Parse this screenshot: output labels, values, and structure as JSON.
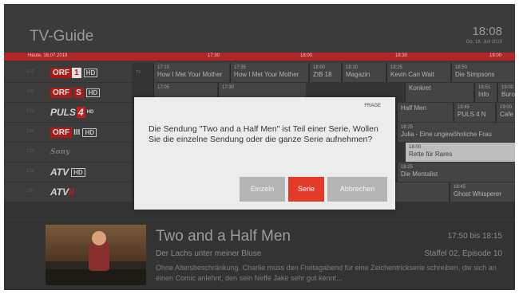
{
  "header": {
    "title": "TV-Guide",
    "clock": "18:08",
    "date": "Do, 18. Juli 2019"
  },
  "timeline": {
    "today": "Heute, 18.07.2019",
    "ticks": [
      "17:30",
      "18:00",
      "18:30",
      "19:00"
    ]
  },
  "channels": [
    {
      "num": "101",
      "logo": "orf1-logo",
      "name_a": "ORF",
      "name_b": "1",
      "hd": "HD"
    },
    {
      "num": "102",
      "logo": "orfs-logo",
      "name_a": "ORF",
      "name_b": "S",
      "hd": "HD"
    },
    {
      "num": "103",
      "logo": "puls4-logo",
      "name_a": "PULS",
      "name_b": "4",
      "hd": "HD"
    },
    {
      "num": "104",
      "logo": "orf3-logo",
      "name_a": "ORF",
      "name_b": "III",
      "hd": "HD"
    },
    {
      "num": "105",
      "logo": "script-logo",
      "name_a": "Sony",
      "name_b": "",
      "hd": ""
    },
    {
      "num": "106",
      "logo": "atv-logo",
      "name_a": "ATV",
      "name_b": "",
      "hd": "HD"
    },
    {
      "num": "107",
      "logo": "atv2-logo",
      "name_a": "ATV",
      "name_b": "II",
      "hd": ""
    }
  ],
  "grid": {
    "tv_tag": "TV",
    "row1": [
      {
        "time": "17:10",
        "name": "How I Met Your Mother"
      },
      {
        "time": "17:35",
        "name": "How I Met Your Mother"
      },
      {
        "time": "18:00",
        "name": "ZIB 18"
      },
      {
        "time": "18:10",
        "name": "Magazin"
      },
      {
        "time": "18:25",
        "name": "Kevin Can Wait"
      },
      {
        "time": "18:50",
        "name": "Die Simpsons"
      }
    ],
    "row2": [
      {
        "time": "17:05",
        "name": ""
      },
      {
        "time": "17:30",
        "name": ""
      },
      {
        "time": "18:51",
        "name": "Info"
      },
      {
        "time": "19:00",
        "name": "Buro"
      }
    ],
    "row2b": {
      "time": "",
      "name": "Konkret"
    },
    "row3": [
      {
        "time": "",
        "name": "Half Men"
      },
      {
        "time": "18:45",
        "name": "PULS 4 N"
      },
      {
        "time": "19:00",
        "name": "Cafe"
      }
    ],
    "row4": {
      "time": "18:25",
      "name": "Julia - Eine ungewöhnliche Frau"
    },
    "row5": {
      "time": "18:00",
      "name": "Rette für Rares"
    },
    "row6": {
      "time": "18:25",
      "name": "Die Mentalist"
    },
    "row7": {
      "time": "18:45",
      "name": "Ghost Whisperer"
    }
  },
  "detail": {
    "title": "Two and a Half Men",
    "time": "17:50 bis 18:15",
    "subtitle": "Der Lachs unter meiner Bluse",
    "season": "Staffel 02, Episode 10",
    "description": "Ohne Altersbeschränkung. Charlie muss den Freitagabend für eine Zeichentrickserie schreiben, die sich an einen Comic anlehnt, den sein Neffe Jake sehr gut kennt..."
  },
  "dialog": {
    "tag": "FRAGE",
    "message": "Die Sendung \"Two and a Half Men\" ist Teil einer Serie. Wollen Sie die einzelne Sendung oder die ganze Serie aufnehmen?",
    "buttons": {
      "single": "Einzeln",
      "series": "Serie",
      "cancel": "Abbrechen"
    }
  },
  "colors": {
    "accent": "#e43a2a",
    "timeline": "#b32626",
    "background": "#3b3b3b"
  }
}
